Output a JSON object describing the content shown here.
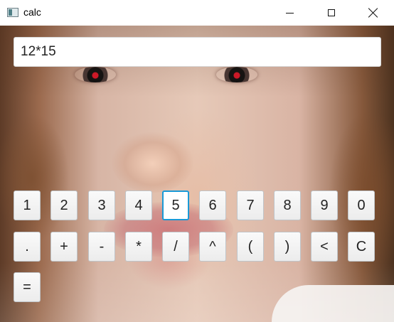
{
  "window": {
    "title": "calc",
    "app_icon": "calculator-window-icon",
    "controls": [
      "minimize-icon",
      "maximize-icon",
      "close-icon"
    ]
  },
  "calculator": {
    "expression": "12*15",
    "focused_key": "5",
    "keys": {
      "k1": "1",
      "k2": "2",
      "k3": "3",
      "k4": "4",
      "k5": "5",
      "k6": "6",
      "k7": "7",
      "k8": "8",
      "k9": "9",
      "k0": "0",
      "dot": ".",
      "plus": "+",
      "minus": "-",
      "multiply": "*",
      "divide": "/",
      "power": "^",
      "lparen": "(",
      "rparen": ")",
      "backspace": "<",
      "clear": "C",
      "equals": "="
    }
  },
  "colors": {
    "focus_accent": "#1a9ad7",
    "window_background": "#ffffff"
  }
}
